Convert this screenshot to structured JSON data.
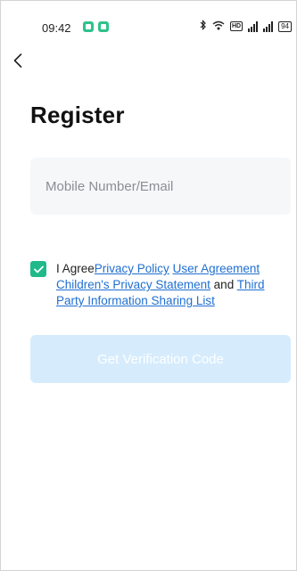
{
  "status_bar": {
    "time": "09:42",
    "battery": "94",
    "hd_label": "HD"
  },
  "header": {
    "back_icon": "chevron-left-icon"
  },
  "page": {
    "title": "Register"
  },
  "account_input": {
    "value": "",
    "placeholder": "Mobile Number/Email"
  },
  "agreement": {
    "checked": true,
    "prefix": "I Agree",
    "privacy_policy": "Privacy Policy",
    "user_agreement": "User Agreement",
    "childrens_privacy": "Children's Privacy Statement",
    "and": "and",
    "third_party": "Third Party Information Sharing List"
  },
  "actions": {
    "get_code_label": "Get Verification Code"
  },
  "colors": {
    "accent": "#1fb98a",
    "link": "#1f6fd1",
    "button_disabled_bg": "#d6ecfd",
    "input_bg": "#f6f7f9"
  }
}
